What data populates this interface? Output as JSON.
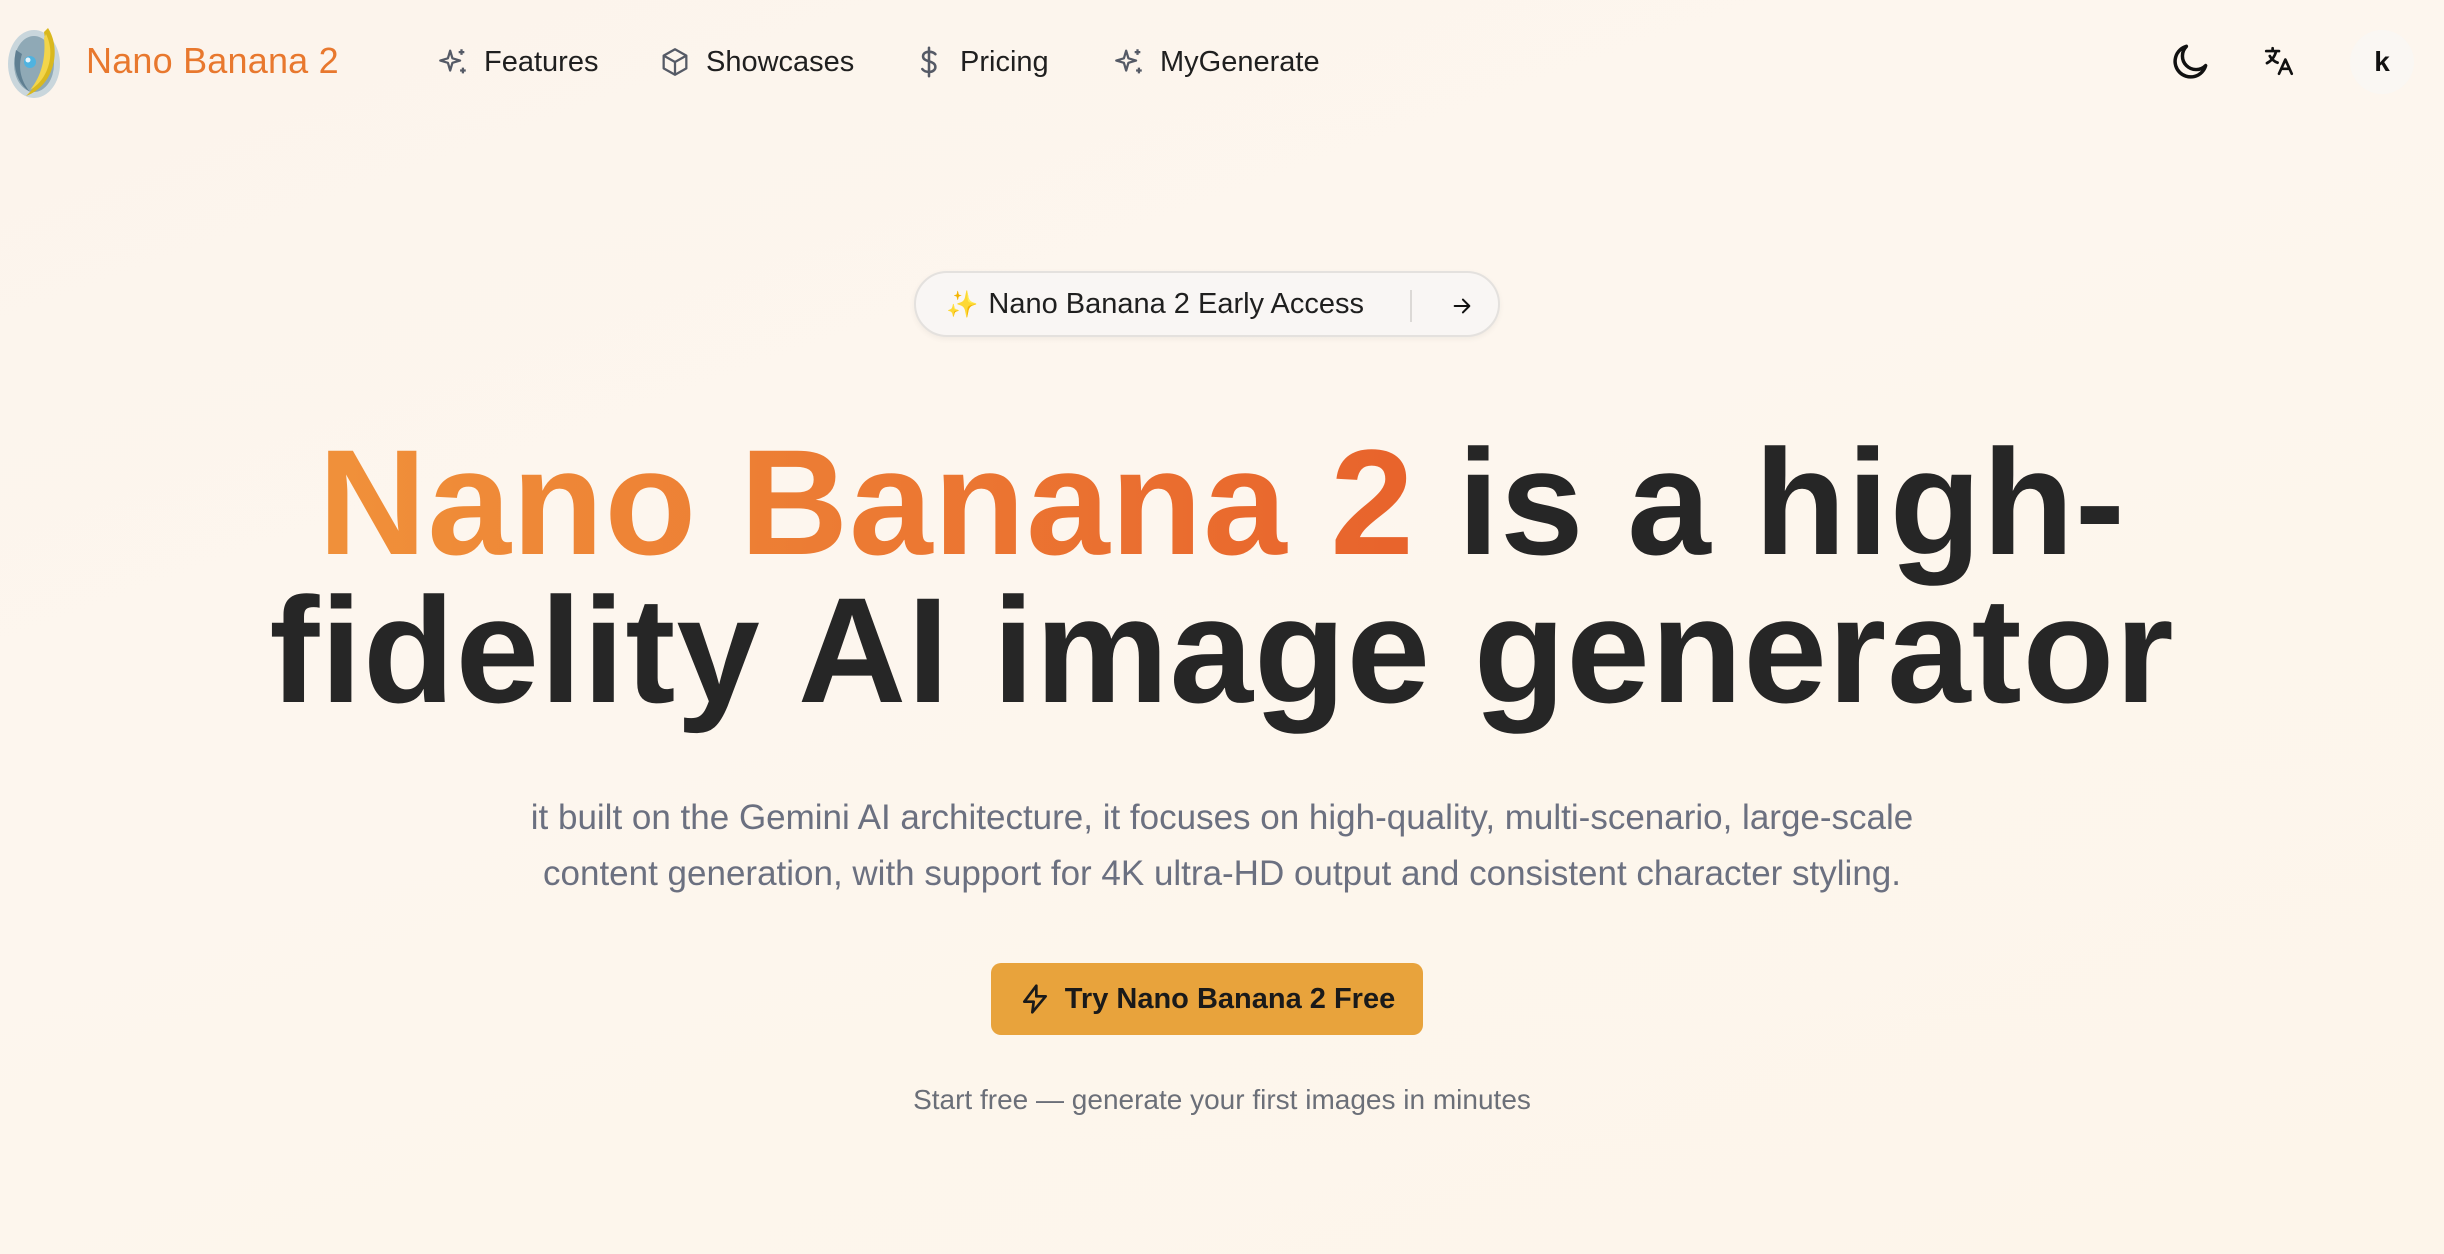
{
  "header": {
    "brand": "Nano Banana 2",
    "nav": [
      {
        "label": "Features",
        "icon": "sparkles-icon"
      },
      {
        "label": "Showcases",
        "icon": "box-icon"
      },
      {
        "label": "Pricing",
        "icon": "dollar-icon"
      },
      {
        "label": "MyGenerate",
        "icon": "sparkles-icon"
      }
    ],
    "theme_icon": "moon-icon",
    "language_icon": "translate-icon",
    "avatar_initial": "k"
  },
  "hero": {
    "badge_spark": "✨",
    "badge_text": "Nano Banana 2 Early Access",
    "headline_accent": "Nano Banana 2",
    "headline_line1_rest": " is a high-",
    "headline_line2": "fidelity AI image generator",
    "subtitle_line1": "it built on the Gemini AI architecture, it focuses on high-quality, multi-scenario, large-scale",
    "subtitle_line2": "content generation, with support for 4K ultra-HD output and consistent character styling.",
    "cta_label": "Try Nano Banana 2 Free",
    "note": "Start free — generate your first images in minutes"
  },
  "colors": {
    "brand": "#e8782e",
    "accent_gradient_start": "#f0913a",
    "accent_gradient_end": "#e8632c",
    "cta_bg": "#e8a33c",
    "background": "#fdf5ec"
  }
}
